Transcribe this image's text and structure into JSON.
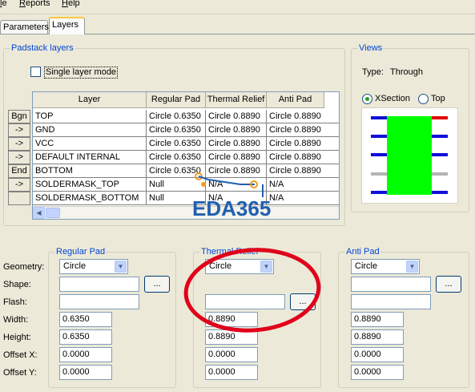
{
  "menu": {
    "items": [
      "le",
      "Reports",
      "Help"
    ]
  },
  "tabs": [
    {
      "label": "Parameters"
    },
    {
      "label": "Layers"
    }
  ],
  "padstack": {
    "group_title": "Padstack layers",
    "single_layer_label": "Single layer mode",
    "columns": [
      "Layer",
      "Regular Pad",
      "Thermal Relief",
      "Anti Pad"
    ],
    "rows": [
      {
        "btn": "Bgn",
        "layer": "TOP",
        "regular": "Circle 0.6350",
        "thermal": "Circle 0.8890",
        "anti": "Circle 0.8890"
      },
      {
        "btn": "->",
        "layer": "GND",
        "regular": "Circle 0.6350",
        "thermal": "Circle 0.8890",
        "anti": "Circle 0.8890"
      },
      {
        "btn": "->",
        "layer": "VCC",
        "regular": "Circle 0.6350",
        "thermal": "Circle 0.8890",
        "anti": "Circle 0.8890"
      },
      {
        "btn": "->",
        "layer": "DEFAULT INTERNAL",
        "regular": "Circle 0.6350",
        "thermal": "Circle 0.8890",
        "anti": "Circle 0.8890"
      },
      {
        "btn": "End",
        "layer": "BOTTOM",
        "regular": "Circle 0.6350",
        "thermal": "Circle 0.8890",
        "anti": "Circle 0.8890"
      },
      {
        "btn": "->",
        "layer": "SOLDERMASK_TOP",
        "regular": "Null",
        "thermal": "N/A",
        "anti": "N/A"
      },
      {
        "btn": "",
        "layer": "SOLDERMASK_BOTTOM",
        "regular": "Null",
        "thermal": "N/A",
        "anti": "N/A"
      }
    ]
  },
  "views": {
    "group_title": "Views",
    "type_label": "Type:",
    "type_value": "Through",
    "xsection_label": "XSection",
    "top_label": "Top",
    "selected": "XSection"
  },
  "form": {
    "row_labels": [
      "Geometry:",
      "Shape:",
      "Flash:",
      "Width:",
      "Height:",
      "Offset X:",
      "Offset Y:"
    ],
    "browse_label": "...",
    "regular": {
      "title": "Regular Pad",
      "geometry": "Circle",
      "shape": "",
      "flash": "",
      "width": "0.6350",
      "height": "0.6350",
      "offset_x": "0.0000",
      "offset_y": "0.0000"
    },
    "thermal": {
      "title": "Thermal Relief",
      "geometry": "Circle",
      "flash": "",
      "width": "0.8890",
      "height": "0.8890",
      "offset_x": "0.0000",
      "offset_y": "0.0000"
    },
    "anti": {
      "title": "Anti Pad",
      "geometry": "Circle",
      "shape": "",
      "flash": "",
      "width": "0.8890",
      "height": "0.8890",
      "offset_x": "0.0000",
      "offset_y": "0.0000"
    }
  },
  "watermark": {
    "text": "EDA365"
  },
  "colors": {
    "accent": "#0046d5",
    "pad_fill": "#00ff00",
    "top_layer": "#e00000",
    "inner_layer": "#0000e0",
    "mask_layer": "#b4b4b4",
    "annotation": "#e0001b"
  }
}
